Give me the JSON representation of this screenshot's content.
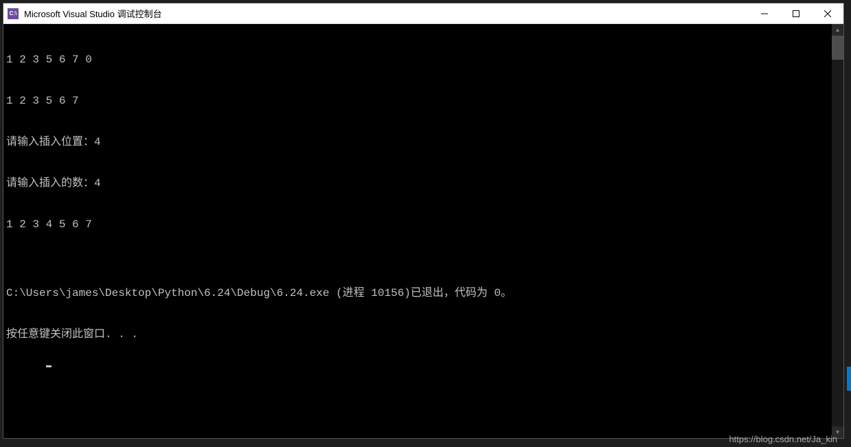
{
  "titlebar": {
    "icon_text": "C:\\",
    "title": "Microsoft Visual Studio 调试控制台"
  },
  "console": {
    "lines": [
      "1 2 3 5 6 7 0",
      "1 2 3 5 6 7",
      "请输入插入位置：4",
      "请输入插入的数：4",
      "1 2 3 4 5 6 7",
      "",
      "C:\\Users\\james\\Desktop\\Python\\6.24\\Debug\\6.24.exe (进程 10156)已退出，代码为 0。",
      "按任意键关闭此窗口. . ."
    ]
  },
  "watermark": "https://blog.csdn.net/Ja_kin"
}
